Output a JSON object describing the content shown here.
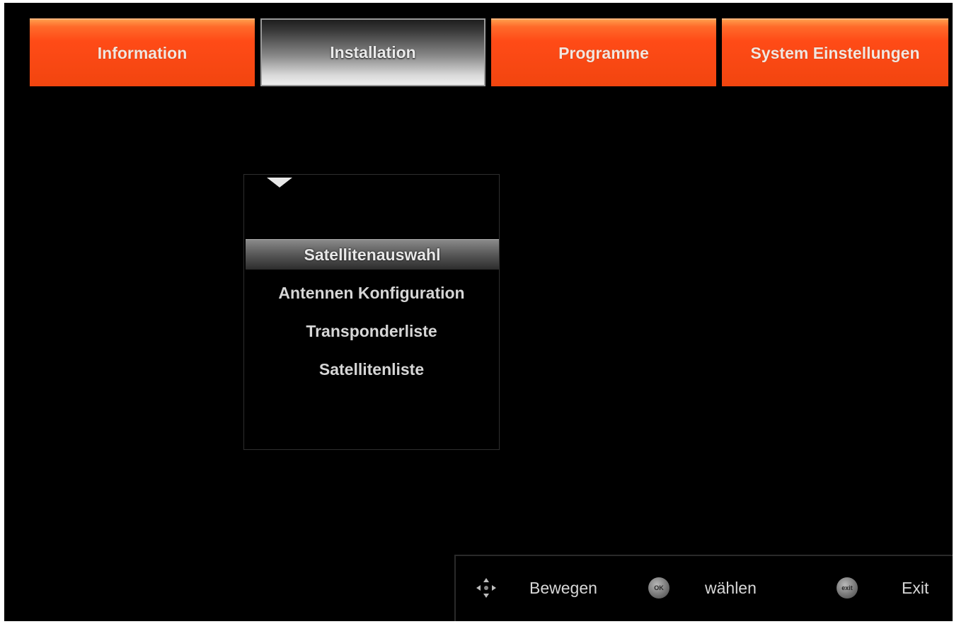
{
  "tabs": [
    {
      "label": "Information",
      "active": false
    },
    {
      "label": "Installation",
      "active": true
    },
    {
      "label": "Programme",
      "active": false
    },
    {
      "label": "System Einstellungen",
      "active": false
    }
  ],
  "submenu": {
    "items": [
      {
        "label": "Satellitenauswahl",
        "selected": true
      },
      {
        "label": "Antennen Konfiguration",
        "selected": false
      },
      {
        "label": "Transponderliste",
        "selected": false
      },
      {
        "label": "Satellitenliste",
        "selected": false
      }
    ],
    "scroll_icon": "triangle-down-icon"
  },
  "footer": {
    "move_icon": "dpad-arrows-icon",
    "move_label": "Bewegen",
    "ok_icon": "ok-button-icon",
    "ok_icon_text": "OK",
    "ok_label": "wählen",
    "exit_icon": "exit-button-icon",
    "exit_icon_text": "exit",
    "exit_label": "Exit"
  },
  "colors": {
    "tab_orange": "#f2450f",
    "background": "#000000",
    "text": "#d6d6d6"
  }
}
